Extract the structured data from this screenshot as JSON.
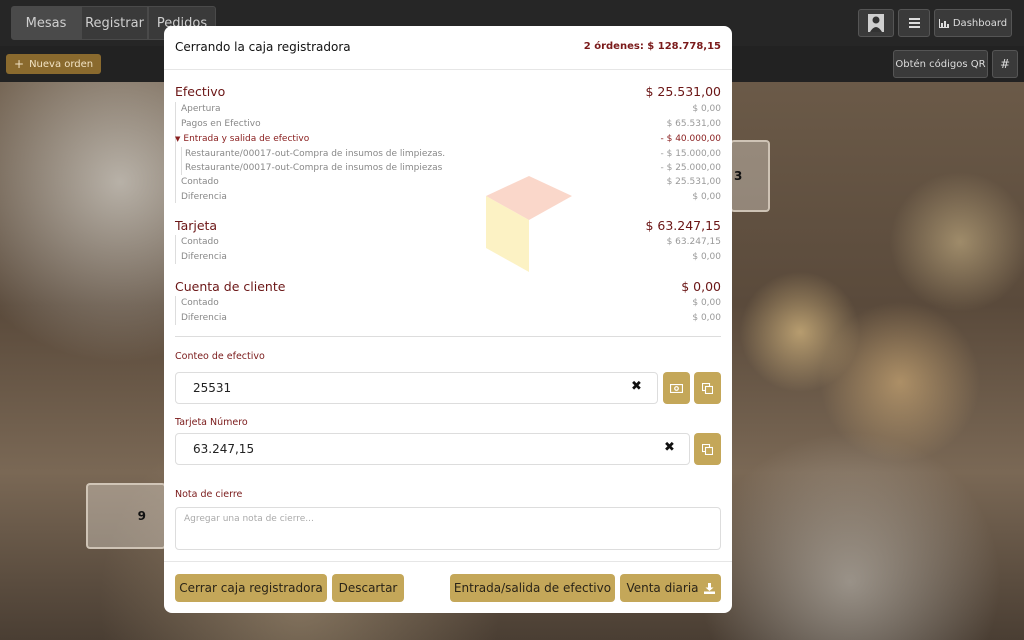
{
  "topbar": {
    "tabs": [
      {
        "label": "Mesas"
      },
      {
        "label": "Registrar"
      },
      {
        "label": "Pedidos"
      }
    ],
    "dashboard_label": "Dashboard",
    "nueva_orden_label": "Nueva orden",
    "qr_label": "Obtén códigos QR",
    "hash_label": "#"
  },
  "background_tables": {
    "table_9": "9",
    "table_3": "3"
  },
  "modal": {
    "title": "Cerrando la caja registradora",
    "orders_summary": "2 órdenes: $ 128.778,15",
    "efectivo": {
      "title": "Efectivo",
      "amount": "$ 25.531,00",
      "rows": [
        {
          "label": "Apertura",
          "value": "$ 0,00"
        },
        {
          "label": "Pagos en Efectivo",
          "value": "$ 65.531,00"
        }
      ],
      "movement_label": "Entrada y salida de efectivo",
      "movement_value": "- $ 40.000,00",
      "movements": [
        {
          "label": "Restaurante/00017-out-Compra de insumos de limpiezas.",
          "value": "- $ 15.000,00"
        },
        {
          "label": "Restaurante/00017-out-Compra de insumos de limpiezas",
          "value": "- $ 25.000,00"
        }
      ],
      "contado_label": "Contado",
      "contado_value": "$ 25.531,00",
      "diferencia_label": "Diferencia",
      "diferencia_value": "$ 0,00"
    },
    "tarjeta": {
      "title": "Tarjeta",
      "amount": "$ 63.247,15",
      "contado_label": "Contado",
      "contado_value": "$ 63.247,15",
      "diferencia_label": "Diferencia",
      "diferencia_value": "$ 0,00"
    },
    "cuenta_cliente": {
      "title": "Cuenta de cliente",
      "amount": "$ 0,00",
      "contado_label": "Contado",
      "contado_value": "$ 0,00",
      "diferencia_label": "Diferencia",
      "diferencia_value": "$ 0,00"
    },
    "conteo": {
      "label": "Conteo de efectivo",
      "value": "25531"
    },
    "tarjeta_numero": {
      "label": "Tarjeta Número",
      "value": "63.247,15"
    },
    "nota": {
      "label": "Nota de cierre",
      "placeholder": "Agregar una nota de cierre..."
    },
    "buttons": {
      "cerrar": "Cerrar caja registradora",
      "descartar": "Descartar",
      "entrada_salida": "Entrada/salida de efectivo",
      "venta_diaria": "Venta diaria"
    }
  },
  "icons": [
    "user-avatar-icon",
    "hamburger-menu-icon",
    "bar-chart-icon",
    "plus-icon",
    "caret-down-icon",
    "money-icon",
    "copy-icon",
    "clear-icon",
    "download-icon"
  ],
  "colors": {
    "accent_gold": "#c4a759",
    "section_title": "#6b1616",
    "topbar_bg": "#262626"
  }
}
